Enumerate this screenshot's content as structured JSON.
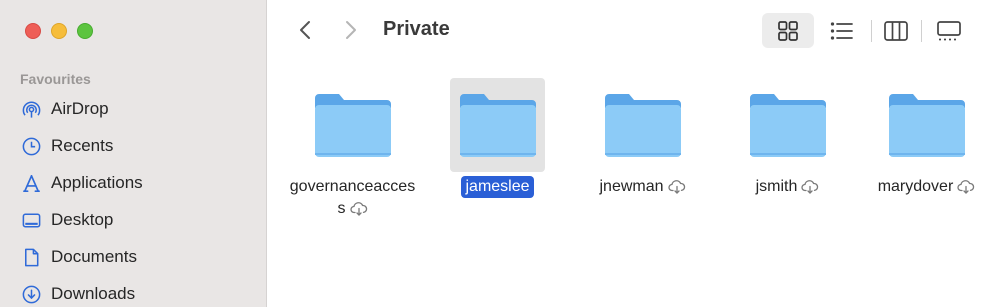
{
  "window": {
    "title": "Private"
  },
  "sidebar": {
    "section_title": "Favourites",
    "items": [
      {
        "label": "AirDrop",
        "icon": "airdrop-icon"
      },
      {
        "label": "Recents",
        "icon": "clock-icon"
      },
      {
        "label": "Applications",
        "icon": "applications-icon"
      },
      {
        "label": "Desktop",
        "icon": "desktop-icon"
      },
      {
        "label": "Documents",
        "icon": "document-icon"
      },
      {
        "label": "Downloads",
        "icon": "download-icon"
      }
    ]
  },
  "toolbar": {
    "back_icon": "chevron-left-icon",
    "forward_icon": "chevron-right-icon",
    "views": [
      "icon-view",
      "list-view",
      "column-view",
      "gallery-view"
    ],
    "active_view": "icon-view"
  },
  "files": [
    {
      "name_line1": "governanceacces",
      "name_line2": "s",
      "icloud": true,
      "selected": false
    },
    {
      "name_line1": "jameslee",
      "icloud": false,
      "selected": true
    },
    {
      "name_line1": "jnewman",
      "icloud": true,
      "selected": false
    },
    {
      "name_line1": "jsmith",
      "icloud": true,
      "selected": false
    },
    {
      "name_line1": "marydover",
      "icloud": true,
      "selected": false
    }
  ],
  "colors": {
    "accent": "#2a5fd6",
    "folder_body": "#8ccbf7",
    "folder_tab": "#5ba6e8",
    "sidebar_icon": "#2f6ad8"
  }
}
